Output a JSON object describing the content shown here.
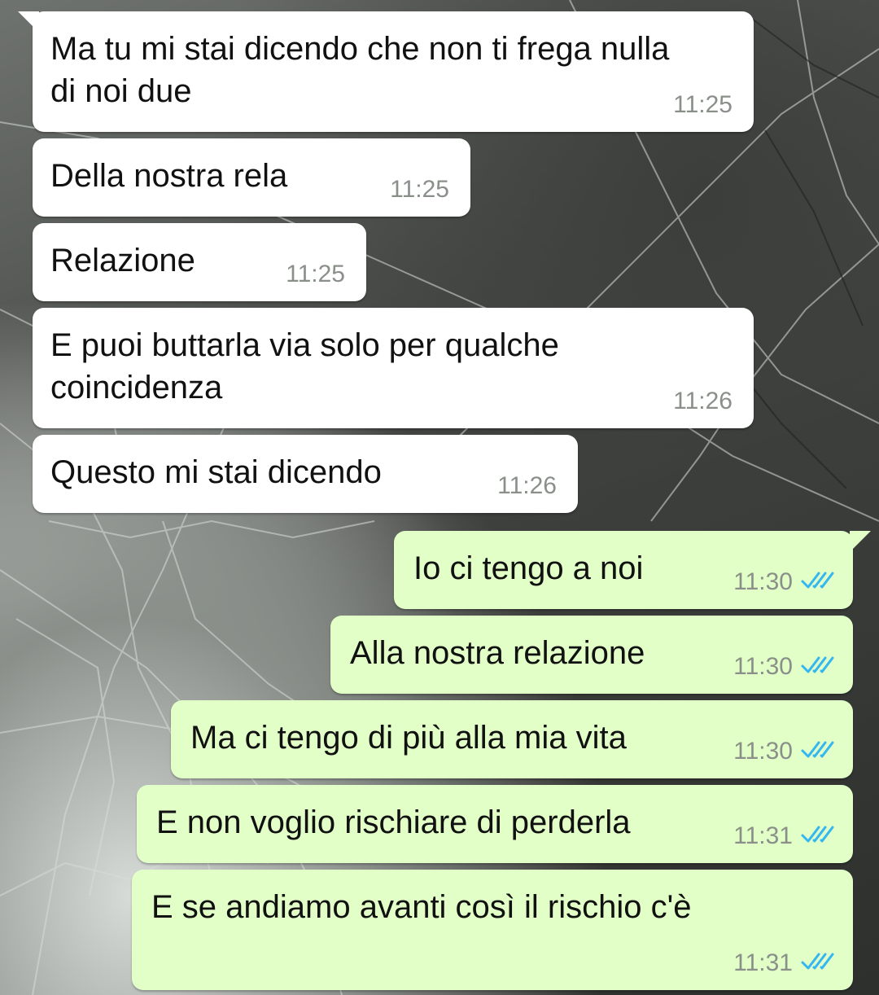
{
  "colors": {
    "incoming_bubble": "#ffffff",
    "outgoing_bubble": "#e1ffc7",
    "timestamp": "#8a8f8a",
    "read_ticks": "#34b7f1"
  },
  "messages": [
    {
      "direction": "incoming",
      "text": "Ma tu mi stai dicendo che non ti frega nulla\ndi noi due",
      "time": "11:25"
    },
    {
      "direction": "incoming",
      "text": "Della nostra rela",
      "time": "11:25"
    },
    {
      "direction": "incoming",
      "text": "Relazione",
      "time": "11:25"
    },
    {
      "direction": "incoming",
      "text": "E puoi buttarla via solo per qualche\ncoincidenza",
      "time": "11:26"
    },
    {
      "direction": "incoming",
      "text": "Questo mi stai dicendo",
      "time": "11:26"
    },
    {
      "direction": "outgoing",
      "text": "Io ci tengo a noi",
      "time": "11:30",
      "status_icon": "double-check-read-icon"
    },
    {
      "direction": "outgoing",
      "text": "Alla nostra relazione",
      "time": "11:30",
      "status_icon": "double-check-read-icon"
    },
    {
      "direction": "outgoing",
      "text": "Ma ci tengo di più alla mia vita",
      "time": "11:30",
      "status_icon": "double-check-read-icon"
    },
    {
      "direction": "outgoing",
      "text": "E non voglio rischiare di perderla",
      "time": "11:31",
      "status_icon": "double-check-read-icon"
    },
    {
      "direction": "outgoing",
      "text": "E se andiamo avanti così il rischio c'è",
      "time": "11:31",
      "status_icon": "double-check-read-icon"
    }
  ]
}
